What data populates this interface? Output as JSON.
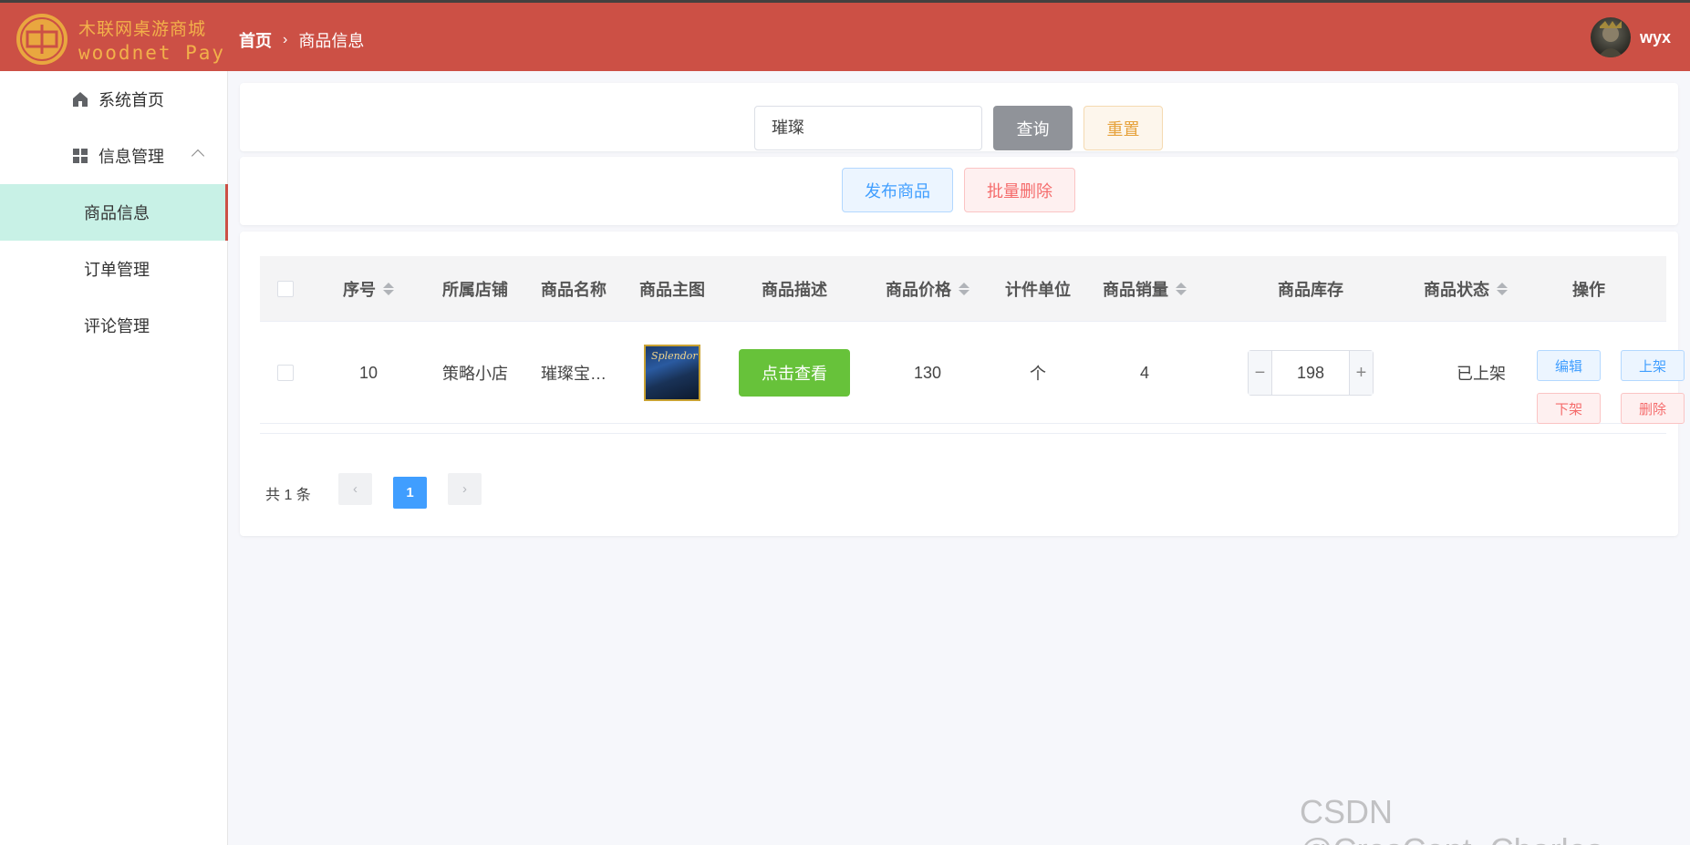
{
  "header": {
    "logo_cn": "木联网桌游商城",
    "logo_en": "woodnet Pay",
    "breadcrumb_home": "首页",
    "breadcrumb_current": "商品信息",
    "username": "wyx",
    "bg_color": "#cc5045"
  },
  "sidebar": {
    "items": [
      {
        "label": "系统首页",
        "icon": "home-icon"
      },
      {
        "label": "信息管理",
        "icon": "grid-icon"
      },
      {
        "label": "商品信息"
      },
      {
        "label": "订单管理"
      },
      {
        "label": "评论管理"
      }
    ]
  },
  "search": {
    "value": "璀璨",
    "query_label": "查询",
    "reset_label": "重置"
  },
  "actions": {
    "publish_label": "发布商品",
    "batch_delete_label": "批量删除"
  },
  "table": {
    "headers": [
      "序号",
      "所属店铺",
      "商品名称",
      "商品主图",
      "商品描述",
      "商品价格",
      "计件单位",
      "商品销量",
      "商品库存",
      "商品状态",
      "操作"
    ],
    "rows": [
      {
        "id": "10",
        "store": "策略小店",
        "name": "璀璨宝…",
        "image_text": "Splendor",
        "desc_button": "点击查看",
        "price": "130",
        "unit": "个",
        "sales": "4",
        "stock": "198",
        "status": "已上架",
        "ops": [
          "编辑",
          "上架",
          "下架",
          "删除"
        ]
      }
    ]
  },
  "pagination": {
    "total_text": "共 1 条",
    "current_page": "1"
  },
  "watermark": "CSDN @CresCent_Charles"
}
